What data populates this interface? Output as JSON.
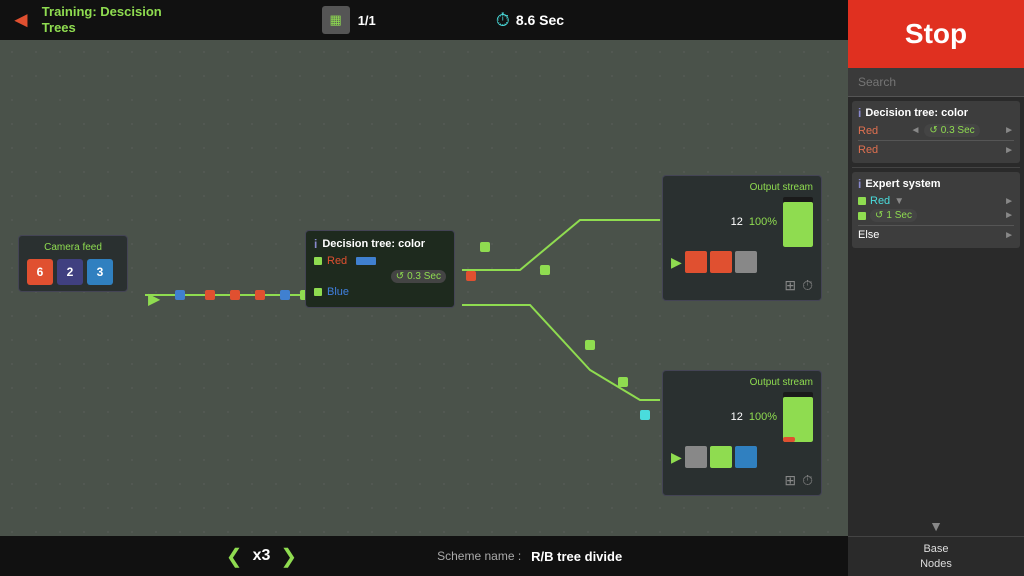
{
  "header": {
    "back_icon": "◄",
    "title_line1": "Training: Descision",
    "title_line2": "Trees",
    "count": "1/1",
    "timer_icon": "⏱",
    "timer_value": "8.6 Sec"
  },
  "right_panel": {
    "stop_label": "Stop",
    "search_placeholder": "Search",
    "scroll_up": "▲",
    "scroll_down": "▼",
    "base_nodes_label": "Base\nNodes",
    "nodes": [
      {
        "type": "Decision tree: color",
        "info": "i",
        "rows": [
          {
            "label": "Red",
            "timer": "0.3 Sec",
            "arrow": "►"
          },
          {
            "label": "Red",
            "arrow": "►"
          }
        ]
      },
      {
        "type": "Expert system",
        "info": "i",
        "rows": [
          {
            "label": "Red",
            "dropdown": true
          },
          {
            "timer": "1 Sec"
          },
          {
            "label": "Else",
            "arrow": "►"
          }
        ]
      }
    ]
  },
  "bottom_bar": {
    "chevron_left": "❮",
    "multiplier": "x3",
    "chevron_right": "❯",
    "scheme_label": "Scheme name :",
    "scheme_name": "R/B tree divide"
  },
  "canvas": {
    "camera_feed": {
      "title": "Camera feed",
      "icons": [
        {
          "label": "6",
          "color": "#e05030"
        },
        {
          "label": "2",
          "color": "#404080"
        },
        {
          "label": "3",
          "color": "#3080c0"
        }
      ]
    },
    "decision_node": {
      "title": "Decision tree: color",
      "info": "i",
      "red_label": "Red",
      "blue_label": "Blue",
      "timer": "0.3 Sec"
    },
    "output_stream_top": {
      "title": "Output stream",
      "count": "12",
      "pct": "100%",
      "bar_green_height": 90,
      "bar_red_height": 15,
      "icons": [
        "red",
        "red",
        "gray"
      ]
    },
    "output_stream_bottom": {
      "title": "Output stream",
      "count": "12",
      "pct": "100%",
      "bar_green_height": 90,
      "bar_red_height": 10,
      "icons": [
        "gray",
        "green",
        "blue"
      ]
    }
  }
}
